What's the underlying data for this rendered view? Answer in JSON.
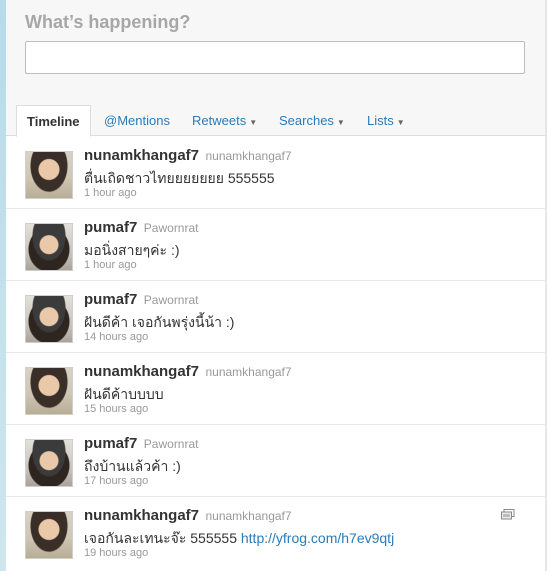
{
  "compose": {
    "heading": "What’s happening?",
    "input_value": ""
  },
  "tabs": [
    {
      "label": "Timeline",
      "active": true,
      "dropdown": false
    },
    {
      "label": "@Mentions",
      "active": false,
      "dropdown": false
    },
    {
      "label": "Retweets",
      "active": false,
      "dropdown": true
    },
    {
      "label": "Searches",
      "active": false,
      "dropdown": true
    },
    {
      "label": "Lists",
      "active": false,
      "dropdown": true
    }
  ],
  "tweets": [
    {
      "screen_name": "nunamkhangaf7",
      "full_name": "nunamkhangaf7",
      "text": "ตื่นเถิดชาวไทยยยยยยย 555555",
      "link": "",
      "time": "1 hour ago",
      "avatar": "avatar-girl"
    },
    {
      "screen_name": "pumaf7",
      "full_name": "Pawornrat",
      "text": "มอนิ่งสายๆค่ะ :)",
      "link": "",
      "time": "1 hour ago",
      "avatar": "avatar-cap"
    },
    {
      "screen_name": "pumaf7",
      "full_name": "Pawornrat",
      "text": "ฝันดีค้า เจอกันพรุ่งนี้น้า :)",
      "link": "",
      "time": "14 hours ago",
      "avatar": "avatar-cap"
    },
    {
      "screen_name": "nunamkhangaf7",
      "full_name": "nunamkhangaf7",
      "text": "ฝันดีค้าบบบบ",
      "link": "",
      "time": "15 hours ago",
      "avatar": "avatar-girl"
    },
    {
      "screen_name": "pumaf7",
      "full_name": "Pawornrat",
      "text": "ถึงบ้านแล้วค้า :)",
      "link": "",
      "time": "17 hours ago",
      "avatar": "avatar-cap"
    },
    {
      "screen_name": "nunamkhangaf7",
      "full_name": "nunamkhangaf7",
      "text": "เจอกันละเทนะจ๊ะ 555555 ",
      "link": "http://yfrog.com/h7ev9qtj",
      "time": "19 hours ago",
      "avatar": "avatar-girl",
      "media_icon": "media-gallery-icon"
    }
  ],
  "colors": {
    "link": "#2b7bb9",
    "muted": "#999999",
    "text": "#333333"
  }
}
